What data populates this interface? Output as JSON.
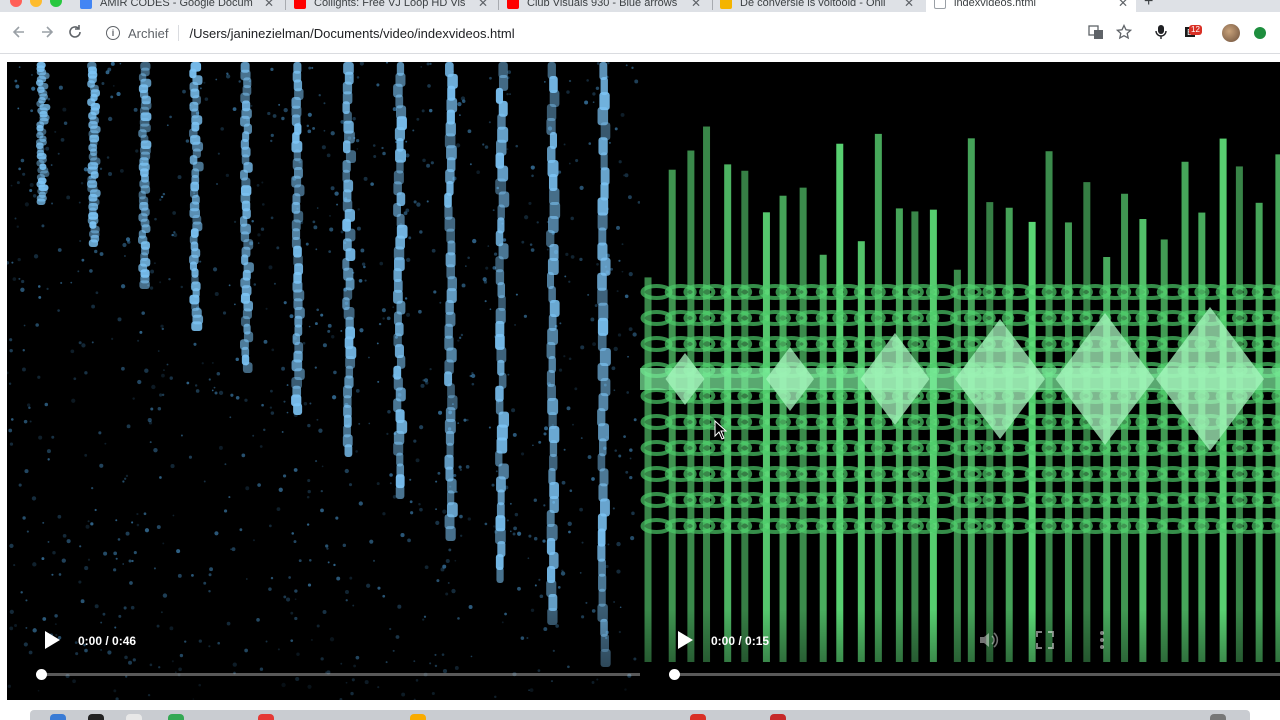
{
  "browser": {
    "tabs": [
      {
        "title": "AMIR CODES - Google Docum",
        "favicon_color": "#4285f4",
        "active": false
      },
      {
        "title": "Coliights: Free VJ Loop HD Vis",
        "favicon_color": "#ff0000",
        "active": false
      },
      {
        "title": "Club Visuals 930 - Blue arrows",
        "favicon_color": "#ff0000",
        "active": false
      },
      {
        "title": "De conversie is voltooid - Onli",
        "favicon_color": "#f4b400",
        "active": false
      },
      {
        "title": "indexvideos.html",
        "favicon_color": "#ffffff",
        "active": true
      }
    ],
    "address_bar": {
      "scheme_label": "Archief",
      "url": "/Users/janinezielman/Documents/video/indexvideos.html"
    },
    "extension_badge": "12"
  },
  "videos": [
    {
      "time": "0:00 / 0:46",
      "progress_fraction": 0.0,
      "accent": "#4fa3e0"
    },
    {
      "time": "0:00 / 0:15",
      "progress_fraction": 0.0,
      "accent": "#5fe07a"
    }
  ],
  "icons": {
    "back": "back-arrow-icon",
    "forward": "forward-arrow-icon",
    "reload": "reload-icon",
    "info": "info-icon",
    "translate": "translate-icon",
    "bookmark": "star-icon",
    "mic": "microphone-icon",
    "volume": "volume-icon",
    "fullscreen": "fullscreen-icon",
    "more": "more-vert-icon"
  }
}
